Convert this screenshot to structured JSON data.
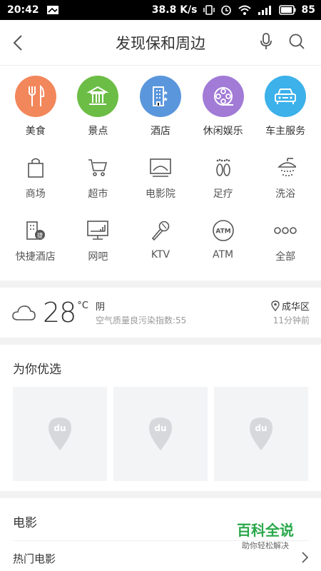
{
  "status_bar": {
    "time": "20:42",
    "speed": "38.8 K/s",
    "battery": "85"
  },
  "header": {
    "title": "发现保和周边"
  },
  "categories": [
    {
      "label": "美食",
      "color": "#f2875b",
      "icon": "fork-knife-icon"
    },
    {
      "label": "景点",
      "color": "#6cbd45",
      "icon": "landmark-icon"
    },
    {
      "label": "酒店",
      "color": "#5a96dc",
      "icon": "hotel-icon"
    },
    {
      "label": "休闲娱乐",
      "color": "#a17bd6",
      "icon": "film-reel-icon"
    },
    {
      "label": "车主服务",
      "color": "#3cb1ea",
      "icon": "car-icon"
    }
  ],
  "services_row1": [
    {
      "label": "商场",
      "icon": "shopping-bag-icon"
    },
    {
      "label": "超市",
      "icon": "cart-icon"
    },
    {
      "label": "电影院",
      "icon": "cinema-icon"
    },
    {
      "label": "足疗",
      "icon": "footprints-icon"
    },
    {
      "label": "洗浴",
      "icon": "shower-icon"
    }
  ],
  "services_row2": [
    {
      "label": "快捷酒店",
      "icon": "express-hotel-icon"
    },
    {
      "label": "网吧",
      "icon": "monitor-icon"
    },
    {
      "label": "KTV",
      "icon": "microphone-icon"
    },
    {
      "label": "ATM",
      "icon": "atm-icon"
    },
    {
      "label": "全部",
      "icon": "more-icon"
    }
  ],
  "weather": {
    "temp": "28",
    "unit": "°C",
    "condition": "阴",
    "air_quality": "空气质量良污染指数:55",
    "location": "成华区",
    "updated": "11分钟前"
  },
  "recommend": {
    "title": "为你优选",
    "placeholder_logo": "du"
  },
  "movies": {
    "title": "电影",
    "hot_label": "热门电影"
  },
  "watermark": {
    "title": "百科全说",
    "subtitle": "助你轻松解决"
  }
}
